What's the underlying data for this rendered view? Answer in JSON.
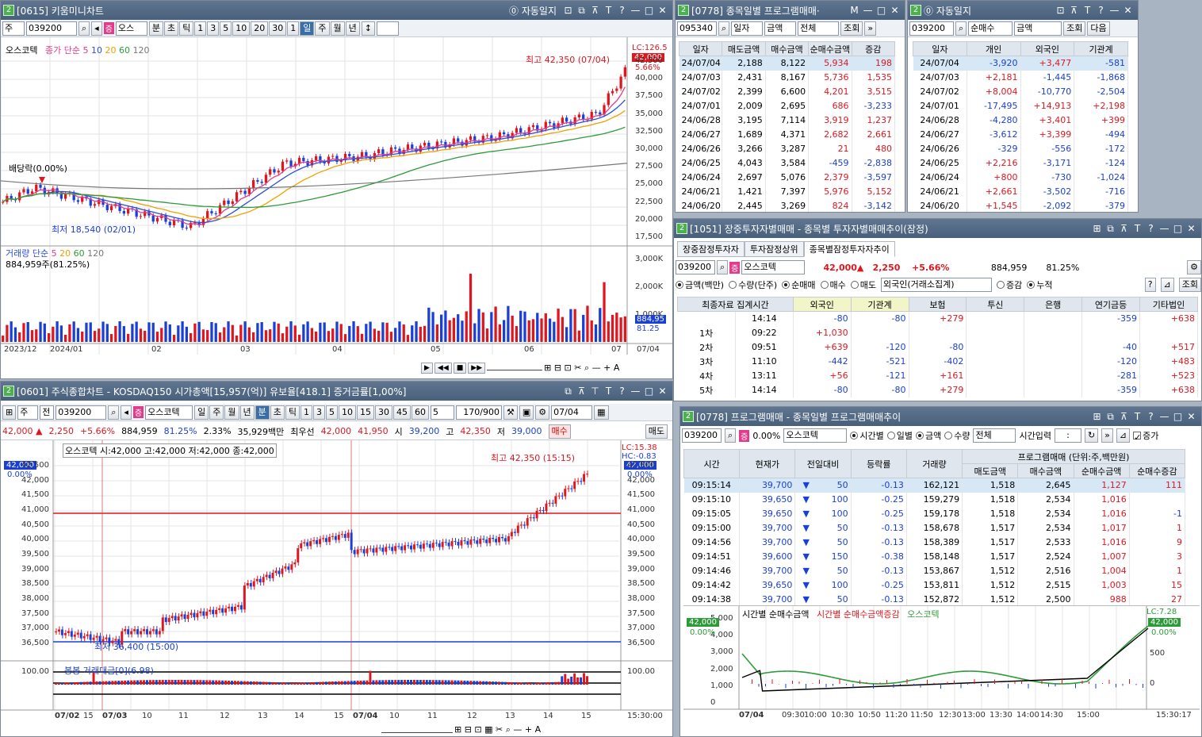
{
  "w1": {
    "num": "2",
    "title": "[0615] 키움미니차트",
    "autolog": "자동일지",
    "toolbar": {
      "type": "주",
      "code": "039200",
      "name": "오스",
      "items": [
        "분",
        "초",
        "틱",
        "1",
        "3",
        "5",
        "10",
        "20",
        "30",
        "1",
        "일",
        "주",
        "월",
        "년"
      ]
    },
    "legend_name": "오스코텍",
    "legend_close": "종가 단순",
    "legend_ma": [
      "5",
      "10",
      "20",
      "60",
      "120"
    ],
    "high_label": "최고 42,350 (07/04)",
    "low_label": "최저 18,540 (02/01)",
    "div_label": "배당락(0.00%)",
    "lc": "LC:126.5",
    "price": "42,000",
    "pct": "5.66%",
    "yaxis": [
      "42,500",
      "40,000",
      "37,500",
      "35,000",
      "32,500",
      "30,000",
      "27,500",
      "25,000",
      "22,500",
      "20,000",
      "17,500"
    ],
    "vol_legend": "거래량 단순",
    "vol_ma": [
      "5",
      "20",
      "60",
      "120"
    ],
    "vol_now": "884,959주(81.25%)",
    "vol_axis": [
      "3,000K",
      "2,000K",
      "1,000K"
    ],
    "vol_price": "884,95",
    "vol_pct": "81.25",
    "xaxis": [
      "2023/12",
      "2024/01",
      "02",
      "03",
      "04",
      "05",
      "06",
      "07",
      "07/04"
    ]
  },
  "w2": {
    "num": "2",
    "title": "[0778] 종목일별 프로그램매매·",
    "code": "095340",
    "sel1": "일자",
    "sel2": "금액",
    "sel3": "전체",
    "query": "조회",
    "headers": [
      "일자",
      "매도금액",
      "매수금액",
      "순매수금액",
      "증감"
    ],
    "rows": [
      [
        "24/07/04",
        "2,188",
        "8,122",
        "5,934",
        "198"
      ],
      [
        "24/07/03",
        "2,431",
        "8,167",
        "5,736",
        "1,535"
      ],
      [
        "24/07/02",
        "2,399",
        "6,600",
        "4,201",
        "3,515"
      ],
      [
        "24/07/01",
        "2,009",
        "2,695",
        "686",
        "-3,233"
      ],
      [
        "24/06/28",
        "3,195",
        "7,114",
        "3,919",
        "1,237"
      ],
      [
        "24/06/27",
        "1,689",
        "4,371",
        "2,682",
        "2,661"
      ],
      [
        "24/06/26",
        "3,266",
        "3,287",
        "21",
        "480"
      ],
      [
        "24/06/25",
        "4,043",
        "3,584",
        "-459",
        "-2,838"
      ],
      [
        "24/06/24",
        "2,697",
        "5,076",
        "2,379",
        "-3,597"
      ],
      [
        "24/06/21",
        "1,421",
        "7,397",
        "5,976",
        "5,152"
      ],
      [
        "24/06/20",
        "2,445",
        "3,269",
        "824",
        "-3,142"
      ]
    ]
  },
  "w3": {
    "num": "2",
    "title": "",
    "autolog": "자동일지",
    "code": "039200",
    "sel1": "순매수",
    "sel2": "금액",
    "query": "조회",
    "next": "다음",
    "headers": [
      "일자",
      "개인",
      "외국인",
      "기관계"
    ],
    "rows": [
      [
        "24/07/04",
        "-3,920",
        "+3,477",
        "-581"
      ],
      [
        "24/07/03",
        "+2,181",
        "-1,445",
        "-1,868"
      ],
      [
        "24/07/02",
        "+8,004",
        "-10,770",
        "-2,504"
      ],
      [
        "24/07/01",
        "-17,495",
        "+14,913",
        "+2,198"
      ],
      [
        "24/06/28",
        "-4,280",
        "+3,401",
        "+399"
      ],
      [
        "24/06/27",
        "-3,612",
        "+3,399",
        "-494"
      ],
      [
        "24/06/26",
        "-329",
        "-556",
        "-172"
      ],
      [
        "24/06/25",
        "+2,216",
        "-3,171",
        "-124"
      ],
      [
        "24/06/24",
        "+800",
        "-730",
        "-1,024"
      ],
      [
        "24/06/21",
        "+2,661",
        "-3,502",
        "-716"
      ],
      [
        "24/06/20",
        "+1,545",
        "-2,092",
        "-379"
      ]
    ]
  },
  "w4": {
    "num": "2",
    "title": "[1051] 장중투자자별매매 - 종목별 투자자별매매추이(잠정)",
    "tabs": [
      "장중잠정투자자",
      "투자잠정상위",
      "종목별잠정투자자추이"
    ],
    "code": "039200",
    "name": "오스코텍",
    "price": "42,000▲",
    "change": "2,250",
    "pct": "+5.66%",
    "volume": "884,959",
    "ratio": "81.25%",
    "radios": [
      "금액(백만)",
      "수량(단주)",
      "순매매",
      "매수",
      "매도"
    ],
    "investor": "외국인(거래소집계)",
    "radios2": [
      "증감",
      "누적"
    ],
    "query": "조회",
    "headers": [
      "최종자료 집계시간",
      "외국인",
      "기관계",
      "보험",
      "투신",
      "은행",
      "연기금등",
      "기타법인"
    ],
    "rows": [
      [
        "",
        "14:14",
        "-80",
        "-80",
        "",
        "+279",
        "",
        "-359",
        "+638"
      ],
      [
        "1차",
        "09:22",
        "+1,030",
        "",
        "",
        "",
        "",
        "",
        ""
      ],
      [
        "2차",
        "09:51",
        "+639",
        "-120",
        "",
        "-80",
        "",
        "-40",
        "+517"
      ],
      [
        "3차",
        "11:10",
        "-442",
        "-521",
        "",
        "-402",
        "",
        "-120",
        "+483"
      ],
      [
        "4차",
        "13:11",
        "+56",
        "-121",
        "",
        "+161",
        "",
        "-281",
        "+523"
      ],
      [
        "5차",
        "14:14",
        "-80",
        "-80",
        "",
        "+279",
        "",
        "-359",
        "+638"
      ]
    ]
  },
  "w5": {
    "num": "2",
    "title": "[0601] 주식종합차트 - KOSDAQ150 시가총액[15,957(억)] 유보율[418.1] 증거금률[1,00%]",
    "toolbar": {
      "type": "주",
      "mode": "전",
      "code": "039200",
      "name": "오스코텍",
      "periods": [
        "일",
        "주",
        "월",
        "년",
        "분",
        "초",
        "틱",
        "1",
        "3",
        "5",
        "10",
        "15",
        "30",
        "45",
        "60"
      ],
      "n": "5",
      "count": "170/900",
      "date": "07/04"
    },
    "quote": {
      "price": "42,000 ▲",
      "change": "2,250",
      "pct": "+5.66%",
      "volume": "884,959",
      "ratio": "81.25%",
      "turn": "2.33%",
      "amount": "35,929백만",
      "best": "최우선",
      "ask": "42,000",
      "bid": "41,950",
      "open_l": "시",
      "open": "39,200",
      "high_l": "고",
      "high": "42,350",
      "low_l": "저",
      "low": "39,000",
      "buy": "매수",
      "sell": "매도"
    },
    "legend": "오스코텍 시:42,000 고:42,000 저:42,000 종:42,000",
    "high_label": "최고 42,350 (15:15)",
    "low_label": "최저 36,400 (15:00)",
    "lc": "LC:15.38",
    "hc": "HC:-0.83",
    "price": "42,000",
    "pct": "0.00%",
    "yaxis": [
      "42,500",
      "42,000",
      "41,500",
      "41,000",
      "40,500",
      "40,000",
      "39,500",
      "39,000",
      "38,500",
      "38,000",
      "37,500",
      "37,000",
      "36,500"
    ],
    "sub_legend": "봉봉 거래대금[0](6.98)",
    "sub_axis": "100.00",
    "xaxis": [
      "07/02",
      "15",
      "07/03",
      "10",
      "11",
      "12",
      "13",
      "14",
      "15",
      "07/04",
      "10",
      "11",
      "12",
      "13",
      "14",
      "15"
    ],
    "time": "15:30:00"
  },
  "w6": {
    "num": "2",
    "title": "[0778] 프로그램매매 - 종목일별 프로그램매매추이",
    "code": "039200",
    "pct": "0.00%",
    "name": "오스코텍",
    "radios": [
      "시간별",
      "일별",
      "금액",
      "수량"
    ],
    "sel": "전체",
    "timeinput": "시간입력",
    "timeval": ":",
    "amount": "증가",
    "headers": [
      "시간",
      "현재가",
      "전일대비",
      "등락률",
      "거래량"
    ],
    "prog_header": "프로그램매매 (단위:주,백만원)",
    "sub_headers": [
      "매도금액",
      "매수금액",
      "순매수금액",
      "순매수증감"
    ],
    "rows": [
      [
        "09:15:14",
        "39,700",
        "50",
        "-0.13",
        "162,121",
        "1,518",
        "2,645",
        "1,127",
        "111"
      ],
      [
        "09:15:10",
        "39,650",
        "100",
        "-0.25",
        "159,279",
        "1,518",
        "2,534",
        "1,016",
        ""
      ],
      [
        "09:15:05",
        "39,650",
        "100",
        "-0.25",
        "159,178",
        "1,518",
        "2,534",
        "1,016",
        "-1"
      ],
      [
        "09:15:00",
        "39,700",
        "50",
        "-0.13",
        "158,678",
        "1,517",
        "2,534",
        "1,017",
        "1"
      ],
      [
        "09:14:56",
        "39,700",
        "50",
        "-0.13",
        "158,389",
        "1,517",
        "2,533",
        "1,016",
        "9"
      ],
      [
        "09:14:51",
        "39,600",
        "150",
        "-0.38",
        "158,148",
        "1,517",
        "2,524",
        "1,007",
        "3"
      ],
      [
        "09:14:46",
        "39,700",
        "50",
        "-0.13",
        "153,867",
        "1,512",
        "2,516",
        "1,004",
        "1"
      ],
      [
        "09:14:42",
        "39,650",
        "100",
        "-0.25",
        "153,811",
        "1,512",
        "2,515",
        "1,003",
        "15"
      ],
      [
        "09:14:38",
        "39,700",
        "50",
        "-0.13",
        "152,872",
        "1,512",
        "2,500",
        "988",
        "27"
      ]
    ],
    "chart_legend": [
      "시간별 순매수금액",
      "시간별 순매수금액증감",
      "오스코텍"
    ],
    "yaxis": [
      "5,000",
      "4,000",
      "3,000",
      "2,000",
      "1,000",
      "0"
    ],
    "yaxis_r": [
      "500",
      "0"
    ],
    "lc": "LC:7.28",
    "price": "42,000",
    "xaxis": [
      "07/04",
      "09:30",
      "10:00",
      "10:30",
      "10:50",
      "11:20",
      "11:50",
      "12:30",
      "13:00",
      "13:30",
      "14:00",
      "14:30",
      "15:00"
    ],
    "time": "15:30:17"
  },
  "colors": {
    "up": "#e0161f",
    "down": "#1a3fd6",
    "ma5": "#e23b8c",
    "ma10": "#2b4fd8",
    "ma20": "#f0a000",
    "ma60": "#2e9b3a",
    "ma120": "#777777"
  }
}
